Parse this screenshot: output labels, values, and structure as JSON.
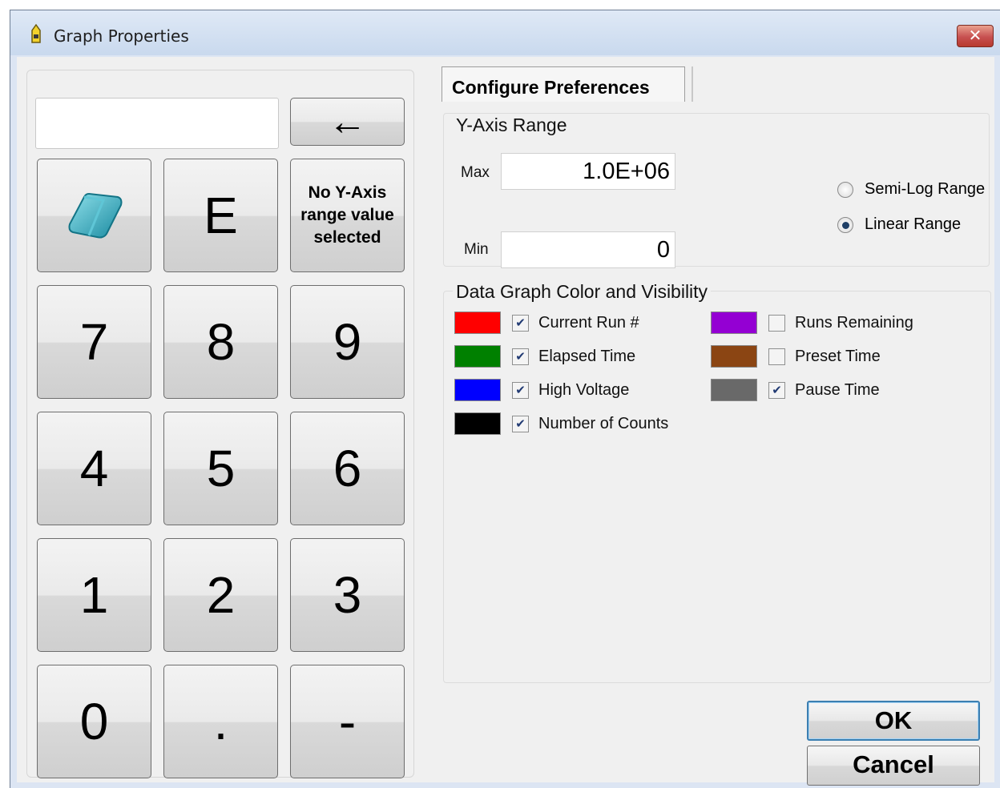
{
  "window": {
    "title": "Graph Properties",
    "close_symbol": "✕"
  },
  "keypad": {
    "display_value": "",
    "backspace_symbol": "←",
    "keys": {
      "eraser": "eraser-icon",
      "e": "E",
      "no_y_axis": "No Y-Axis range value selected",
      "k7": "7",
      "k8": "8",
      "k9": "9",
      "k4": "4",
      "k5": "5",
      "k6": "6",
      "k1": "1",
      "k2": "2",
      "k3": "3",
      "k0": "0",
      "dot": ".",
      "minus": "-"
    }
  },
  "tabs": {
    "active": "Configure Preferences"
  },
  "y_axis": {
    "title": "Y-Axis Range",
    "max_label": "Max",
    "max_value": "1.0E+06",
    "min_label": "Min",
    "min_value": "0",
    "options": [
      {
        "label": "Semi-Log Range",
        "checked": false
      },
      {
        "label": "Linear Range",
        "checked": true
      }
    ]
  },
  "data_graph": {
    "title": "Data Graph Color and Visibility",
    "series": [
      {
        "label": "Current Run #",
        "color": "#ff0000",
        "checked": true
      },
      {
        "label": "Elapsed Time",
        "color": "#008000",
        "checked": true
      },
      {
        "label": "High Voltage",
        "color": "#0000ff",
        "checked": true
      },
      {
        "label": "Number of Counts",
        "color": "#000000",
        "checked": true
      },
      {
        "label": "Runs Remaining",
        "color": "#9400d3",
        "checked": false
      },
      {
        "label": "Preset Time",
        "color": "#8b4513",
        "checked": false
      },
      {
        "label": "Pause Time",
        "color": "#696969",
        "checked": true
      }
    ]
  },
  "buttons": {
    "ok": "OK",
    "cancel": "Cancel"
  }
}
